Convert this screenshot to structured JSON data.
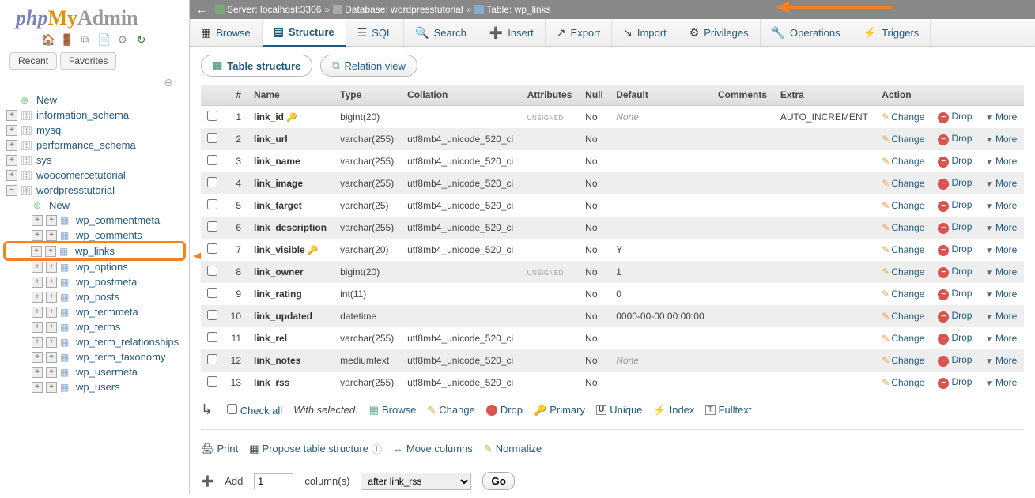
{
  "logo": {
    "php": "php",
    "my": "My",
    "admin": "Admin"
  },
  "sidebar_tabs": {
    "recent": "Recent",
    "favorites": "Favorites"
  },
  "tree": {
    "new": "New",
    "dbs": [
      "information_schema",
      "mysql",
      "performance_schema",
      "sys",
      "woocomercetutorial"
    ],
    "current_db": "wordpresstutorial",
    "new_table": "New",
    "tables": [
      "wp_commentmeta",
      "wp_comments",
      "wp_links",
      "wp_options",
      "wp_postmeta",
      "wp_posts",
      "wp_termmeta",
      "wp_terms",
      "wp_term_relationships",
      "wp_term_taxonomy",
      "wp_usermeta",
      "wp_users"
    ],
    "highlighted": "wp_links"
  },
  "breadcrumb": {
    "server_label": "Server:",
    "server": "localhost:3306",
    "db_label": "Database:",
    "db": "wordpresstutorial",
    "table_label": "Table:",
    "table": "wp_links"
  },
  "tabs": [
    {
      "label": "Browse",
      "icon": "▦"
    },
    {
      "label": "Structure",
      "icon": "▤",
      "active": true
    },
    {
      "label": "SQL",
      "icon": "☰"
    },
    {
      "label": "Search",
      "icon": "🔍"
    },
    {
      "label": "Insert",
      "icon": "➕"
    },
    {
      "label": "Export",
      "icon": "↗"
    },
    {
      "label": "Import",
      "icon": "↘"
    },
    {
      "label": "Privileges",
      "icon": "⚙"
    },
    {
      "label": "Operations",
      "icon": "🔧"
    },
    {
      "label": "Triggers",
      "icon": "⚡"
    }
  ],
  "subtabs": {
    "structure": "Table structure",
    "relation": "Relation view"
  },
  "headers": {
    "num": "#",
    "name": "Name",
    "type": "Type",
    "collation": "Collation",
    "attributes": "Attributes",
    "null": "Null",
    "default": "Default",
    "comments": "Comments",
    "extra": "Extra",
    "action": "Action"
  },
  "action_labels": {
    "change": "Change",
    "drop": "Drop",
    "more": "More"
  },
  "columns": [
    {
      "n": 1,
      "name": "link_id",
      "type": "bigint(20)",
      "coll": "",
      "attr": "UNSIGNED",
      "null": "No",
      "def": "None",
      "defItalic": true,
      "extra": "AUTO_INCREMENT",
      "key": true
    },
    {
      "n": 2,
      "name": "link_url",
      "type": "varchar(255)",
      "coll": "utf8mb4_unicode_520_ci",
      "attr": "",
      "null": "No",
      "def": "",
      "extra": ""
    },
    {
      "n": 3,
      "name": "link_name",
      "type": "varchar(255)",
      "coll": "utf8mb4_unicode_520_ci",
      "attr": "",
      "null": "No",
      "def": "",
      "extra": ""
    },
    {
      "n": 4,
      "name": "link_image",
      "type": "varchar(255)",
      "coll": "utf8mb4_unicode_520_ci",
      "attr": "",
      "null": "No",
      "def": "",
      "extra": ""
    },
    {
      "n": 5,
      "name": "link_target",
      "type": "varchar(25)",
      "coll": "utf8mb4_unicode_520_ci",
      "attr": "",
      "null": "No",
      "def": "",
      "extra": ""
    },
    {
      "n": 6,
      "name": "link_description",
      "type": "varchar(255)",
      "coll": "utf8mb4_unicode_520_ci",
      "attr": "",
      "null": "No",
      "def": "",
      "extra": ""
    },
    {
      "n": 7,
      "name": "link_visible",
      "type": "varchar(20)",
      "coll": "utf8mb4_unicode_520_ci",
      "attr": "",
      "null": "No",
      "def": "Y",
      "extra": "",
      "index": true
    },
    {
      "n": 8,
      "name": "link_owner",
      "type": "bigint(20)",
      "coll": "",
      "attr": "UNSIGNED",
      "null": "No",
      "def": "1",
      "extra": ""
    },
    {
      "n": 9,
      "name": "link_rating",
      "type": "int(11)",
      "coll": "",
      "attr": "",
      "null": "No",
      "def": "0",
      "extra": ""
    },
    {
      "n": 10,
      "name": "link_updated",
      "type": "datetime",
      "coll": "",
      "attr": "",
      "null": "No",
      "def": "0000-00-00 00:00:00",
      "extra": ""
    },
    {
      "n": 11,
      "name": "link_rel",
      "type": "varchar(255)",
      "coll": "utf8mb4_unicode_520_ci",
      "attr": "",
      "null": "No",
      "def": "",
      "extra": ""
    },
    {
      "n": 12,
      "name": "link_notes",
      "type": "mediumtext",
      "coll": "utf8mb4_unicode_520_ci",
      "attr": "",
      "null": "No",
      "def": "None",
      "defItalic": true,
      "extra": ""
    },
    {
      "n": 13,
      "name": "link_rss",
      "type": "varchar(255)",
      "coll": "utf8mb4_unicode_520_ci",
      "attr": "",
      "null": "No",
      "def": "",
      "extra": ""
    }
  ],
  "checkall": {
    "label": "Check all",
    "withsel": "With selected:",
    "browse": "Browse",
    "change": "Change",
    "drop": "Drop",
    "primary": "Primary",
    "unique": "Unique",
    "index": "Index",
    "fulltext": "Fulltext"
  },
  "footer2": {
    "print": "Print",
    "propose": "Propose table structure",
    "movecols": "Move columns",
    "normalize": "Normalize"
  },
  "addrow": {
    "add": "Add",
    "value": "1",
    "cols": "column(s)",
    "after": "after link_rss",
    "go": "Go"
  }
}
